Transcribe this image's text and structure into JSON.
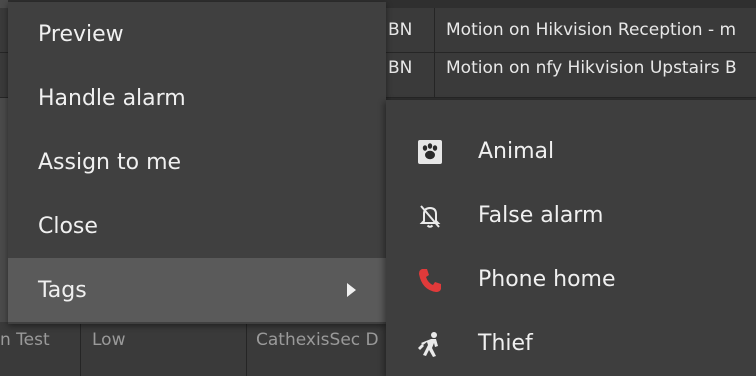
{
  "background_table": {
    "rows": [
      {
        "col_a": "BN",
        "col_b": "Motion on Hikvision Reception - m"
      },
      {
        "col_a": "BN",
        "col_b": "Motion on nfy Hikvision Upstairs B"
      }
    ],
    "bottom_row": {
      "col_name": "n Test",
      "col_priority": "Low",
      "col_site": "CathexisSec D"
    }
  },
  "context_menu": {
    "items": [
      {
        "label": "Preview"
      },
      {
        "label": "Handle alarm"
      },
      {
        "label": "Assign to me"
      },
      {
        "label": "Close"
      },
      {
        "label": "Tags",
        "has_submenu": true,
        "selected": true
      }
    ]
  },
  "tags_submenu": {
    "items": [
      {
        "label": "Animal",
        "icon": "paw-icon"
      },
      {
        "label": "False alarm",
        "icon": "bell-off-icon"
      },
      {
        "label": "Phone home",
        "icon": "phone-icon",
        "icon_color": "#e03a3a"
      },
      {
        "label": "Thief",
        "icon": "thief-icon"
      }
    ]
  },
  "colors": {
    "menu_bg": "#404040",
    "menu_selected_bg": "#5a5a5a",
    "submenu_bg": "#3e3e3e",
    "text": "#f0f0f0",
    "phone_icon": "#e03a3a"
  }
}
